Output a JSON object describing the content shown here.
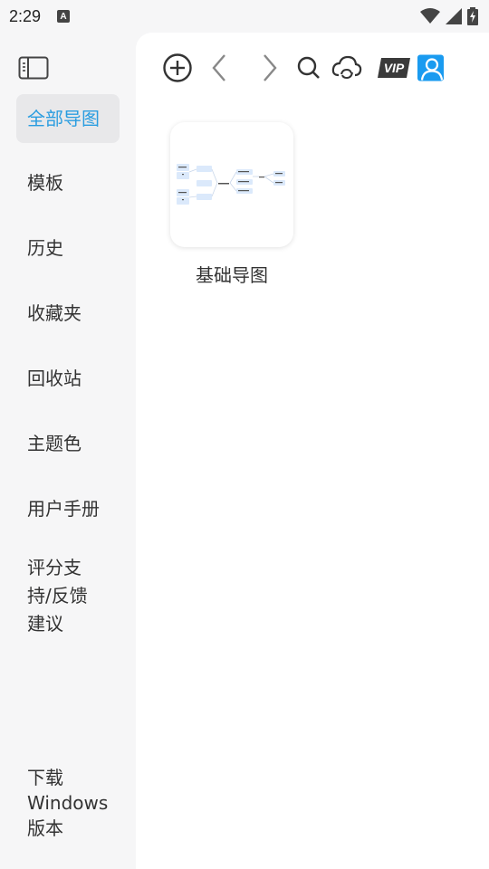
{
  "status": {
    "time": "2:29",
    "badge": "A"
  },
  "sidebar": {
    "items": [
      {
        "label": "全部导图"
      },
      {
        "label": "模板"
      },
      {
        "label": "历史"
      },
      {
        "label": "收藏夹"
      },
      {
        "label": "回收站"
      },
      {
        "label": "主题色"
      },
      {
        "label": "用户手册"
      },
      {
        "label": "评分支持/反馈建议",
        "lines": [
          "评分支",
          "持/反馈",
          "建议"
        ]
      },
      {
        "label": "下载Windows版本",
        "lines": [
          "下载",
          "Windows",
          "版本"
        ]
      }
    ]
  },
  "toolbar": {
    "vip_label": "VIP"
  },
  "files": [
    {
      "title": "基础导图"
    }
  ],
  "colors": {
    "accent": "#2a9de0",
    "avatar": "#1a9bf0"
  }
}
